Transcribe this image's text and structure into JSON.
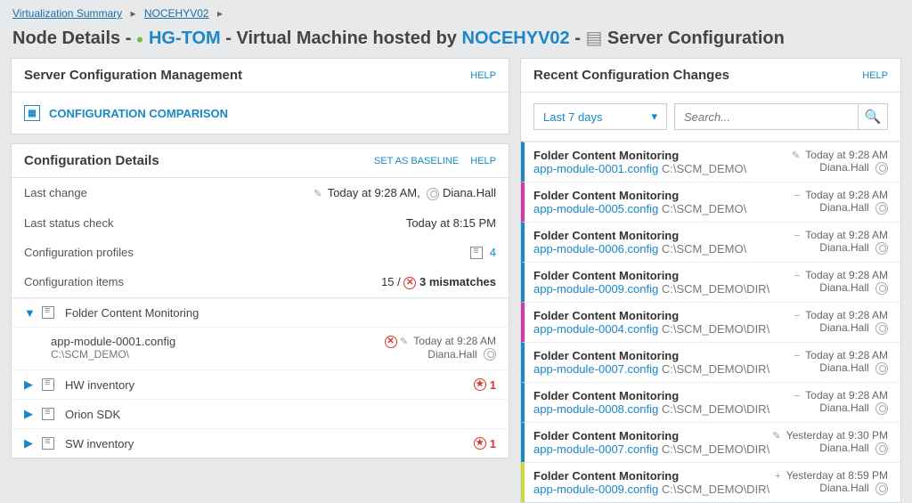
{
  "breadcrumb": {
    "root": "Virtualization Summary",
    "node": "NOCEHYV02"
  },
  "title": {
    "prefix": "Node Details -",
    "host": "HG-TOM",
    "mid": "- Virtual Machine hosted by",
    "hyper": "NOCEHYV02",
    "suffix": "- ",
    "section": "Server Configuration"
  },
  "panels": {
    "scm": {
      "title": "Server Configuration Management",
      "help": "HELP",
      "comparison": "CONFIGURATION COMPARISON"
    },
    "details": {
      "title": "Configuration Details",
      "set_baseline": "SET AS BASELINE",
      "help": "HELP",
      "rows": {
        "last_change_label": "Last change",
        "last_change_value": "Today at 9:28 AM,",
        "last_change_user": "Diana.Hall",
        "last_status_label": "Last status check",
        "last_status_value": "Today at 8:15 PM",
        "profiles_label": "Configuration profiles",
        "profiles_value": "4",
        "items_label": "Configuration items",
        "items_count": "15 /",
        "items_mismatch": "3 mismatches"
      },
      "tree": {
        "folder": "Folder Content Monitoring",
        "child_file": "app-module-0001.config",
        "child_path": "C:\\SCM_DEMO\\",
        "child_time": "Today at 9:28 AM",
        "child_user": "Diana.Hall",
        "hw": "HW inventory",
        "hw_badge": "1",
        "orion": "Orion SDK",
        "sw": "SW inventory",
        "sw_badge": "1"
      }
    },
    "changes": {
      "title": "Recent Configuration Changes",
      "help": "HELP",
      "range": "Last 7 days",
      "search_placeholder": "Search...",
      "items": [
        {
          "color": "#1a87c9",
          "title": "Folder Content Monitoring",
          "file": "app-module-0001.config",
          "path": "C:\\SCM_DEMO\\",
          "icon": "✎",
          "time": "Today at 9:28 AM",
          "user": "Diana.Hall"
        },
        {
          "color": "#d936a4",
          "title": "Folder Content Monitoring",
          "file": "app-module-0005.config",
          "path": "C:\\SCM_DEMO\\",
          "icon": "−",
          "time": "Today at 9:28 AM",
          "user": "Diana.Hall"
        },
        {
          "color": "#1a87c9",
          "title": "Folder Content Monitoring",
          "file": "app-module-0006.config",
          "path": "C:\\SCM_DEMO\\",
          "icon": "−",
          "time": "Today at 9:28 AM",
          "user": "Diana.Hall"
        },
        {
          "color": "#1a87c9",
          "title": "Folder Content Monitoring",
          "file": "app-module-0009.config",
          "path": "C:\\SCM_DEMO\\DIR\\",
          "icon": "−",
          "time": "Today at 9:28 AM",
          "user": "Diana.Hall"
        },
        {
          "color": "#d936a4",
          "title": "Folder Content Monitoring",
          "file": "app-module-0004.config",
          "path": "C:\\SCM_DEMO\\DIR\\",
          "icon": "−",
          "time": "Today at 9:28 AM",
          "user": "Diana.Hall"
        },
        {
          "color": "#1a87c9",
          "title": "Folder Content Monitoring",
          "file": "app-module-0007.config",
          "path": "C:\\SCM_DEMO\\DIR\\",
          "icon": "−",
          "time": "Today at 9:28 AM",
          "user": "Diana.Hall"
        },
        {
          "color": "#1a87c9",
          "title": "Folder Content Monitoring",
          "file": "app-module-0008.config",
          "path": "C:\\SCM_DEMO\\DIR\\",
          "icon": "−",
          "time": "Today at 9:28 AM",
          "user": "Diana.Hall"
        },
        {
          "color": "#1a87c9",
          "title": "Folder Content Monitoring",
          "file": "app-module-0007.config",
          "path": "C:\\SCM_DEMO\\DIR\\",
          "icon": "✎",
          "time": "Yesterday at 9:30 PM",
          "user": "Diana.Hall"
        },
        {
          "color": "#cddc39",
          "title": "Folder Content Monitoring",
          "file": "app-module-0009.config",
          "path": "C:\\SCM_DEMO\\DIR\\",
          "icon": "+",
          "time": "Yesterday at 8:59 PM",
          "user": "Diana.Hall"
        }
      ]
    }
  }
}
